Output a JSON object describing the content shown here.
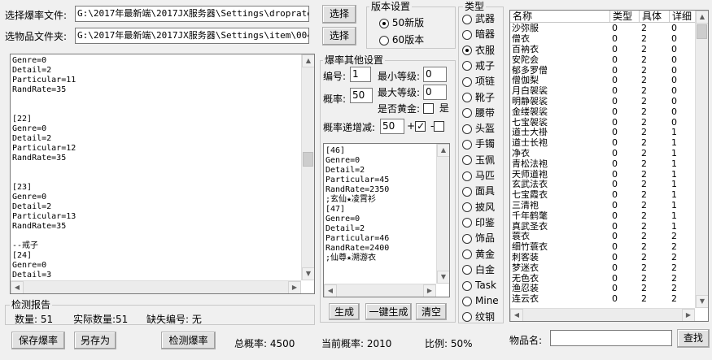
{
  "top": {
    "drop_file_label": "选择爆率文件:",
    "drop_file_path": "G:\\2017年最新端\\2017JX服务器\\Settings\\droprate\\",
    "item_folder_label": "选物品文件夹:",
    "item_folder_path": "G:\\2017年最新端\\2017JX服务器\\Settings\\item\\004\\",
    "select_label": "选择"
  },
  "version": {
    "title": "版本设置",
    "options": [
      "50新版",
      "60版本"
    ],
    "selected": 0
  },
  "left_text": [
    "Genre=0",
    "Detail=2",
    "Particular=11",
    "RandRate=35",
    "",
    "",
    "[22]",
    "Genre=0",
    "Detail=2",
    "Particular=12",
    "RandRate=35",
    "",
    "",
    "[23]",
    "Genre=0",
    "Detail=2",
    "Particular=13",
    "RandRate=35",
    "",
    "--戒子",
    "[24]",
    "Genre=0",
    "Detail=3"
  ],
  "settings": {
    "title": "爆率其他设置",
    "num_label": "编号:",
    "num_value": "1",
    "min_level_label": "最小等级:",
    "min_level_value": "0",
    "rate_label": "概率:",
    "rate_value": "50",
    "max_level_label": "最大等级:",
    "max_level_value": "0",
    "gold_label": "是否黄金:",
    "gold_check_label": "是",
    "inc_label": "概率递增减:",
    "inc_value": "50",
    "plus": "+",
    "minus": "-"
  },
  "mid_text": [
    "[46]",
    "Genre=0",
    "Detail=2",
    "Particular=45",
    "RandRate=2350",
    ";玄仙★凌霄衫",
    "[47]",
    "Genre=0",
    "Detail=2",
    "Particular=46",
    "RandRate=2400",
    ";仙尊★溯游衣"
  ],
  "mid_buttons": {
    "generate": "生成",
    "one_click": "一键生成",
    "clear": "清空"
  },
  "types": {
    "title": "类型",
    "items": [
      "武器",
      "暗器",
      "衣服",
      "戒子",
      "项链",
      "靴子",
      "腰带",
      "头盔",
      "手镯",
      "玉佩",
      "马匹",
      "面具",
      "披风",
      "印鉴",
      "饰品",
      "黄金",
      "白金",
      "Task",
      "Mine",
      "纹钢"
    ],
    "selected": 2
  },
  "item_table": {
    "columns": [
      "名称",
      "类型",
      "具体",
      "详细"
    ],
    "rows": [
      [
        "沙弥服",
        "0",
        "2",
        "0"
      ],
      [
        "僧衣",
        "0",
        "2",
        "0"
      ],
      [
        "百衲衣",
        "0",
        "2",
        "0"
      ],
      [
        "安陀会",
        "0",
        "2",
        "0"
      ],
      [
        "郁多罗僧",
        "0",
        "2",
        "0"
      ],
      [
        "僧伽梨",
        "0",
        "2",
        "0"
      ],
      [
        "月白袈裟",
        "0",
        "2",
        "0"
      ],
      [
        "明静袈裟",
        "0",
        "2",
        "0"
      ],
      [
        "金缕袈裟",
        "0",
        "2",
        "0"
      ],
      [
        "七宝袈裟",
        "0",
        "2",
        "0"
      ],
      [
        "道士大褂",
        "0",
        "2",
        "1"
      ],
      [
        "道士长袍",
        "0",
        "2",
        "1"
      ],
      [
        "净衣",
        "0",
        "2",
        "1"
      ],
      [
        "青松法袍",
        "0",
        "2",
        "1"
      ],
      [
        "天师道袍",
        "0",
        "2",
        "1"
      ],
      [
        "玄武法衣",
        "0",
        "2",
        "1"
      ],
      [
        "七宝霞衣",
        "0",
        "2",
        "1"
      ],
      [
        "三清袍",
        "0",
        "2",
        "1"
      ],
      [
        "千年鹤氅",
        "0",
        "2",
        "1"
      ],
      [
        "真武圣衣",
        "0",
        "2",
        "1"
      ],
      [
        "蓑衣",
        "0",
        "2",
        "2"
      ],
      [
        "细竹蓑衣",
        "0",
        "2",
        "2"
      ],
      [
        "刺客装",
        "0",
        "2",
        "2"
      ],
      [
        "梦迷衣",
        "0",
        "2",
        "2"
      ],
      [
        "无色衣",
        "0",
        "2",
        "2"
      ],
      [
        "渔忍装",
        "0",
        "2",
        "2"
      ],
      [
        "连云衣",
        "0",
        "2",
        "2"
      ]
    ]
  },
  "report": {
    "title": "检测报告",
    "count_label": "数量:",
    "count_value": "51",
    "actual_label": "实际数量:",
    "actual_value": "51",
    "missing_label": "缺失编号:",
    "missing_value": "无"
  },
  "bottom": {
    "save_label": "保存爆率",
    "save_as_label": "另存为",
    "check_label": "检测爆率",
    "total_label": "总概率:",
    "total_value": "4500",
    "current_label": "当前概率:",
    "current_value": "2010",
    "ratio_label": "比例:",
    "ratio_value": "50%",
    "item_name_label": "物品名:",
    "item_name_value": "",
    "search_label": "查找"
  }
}
